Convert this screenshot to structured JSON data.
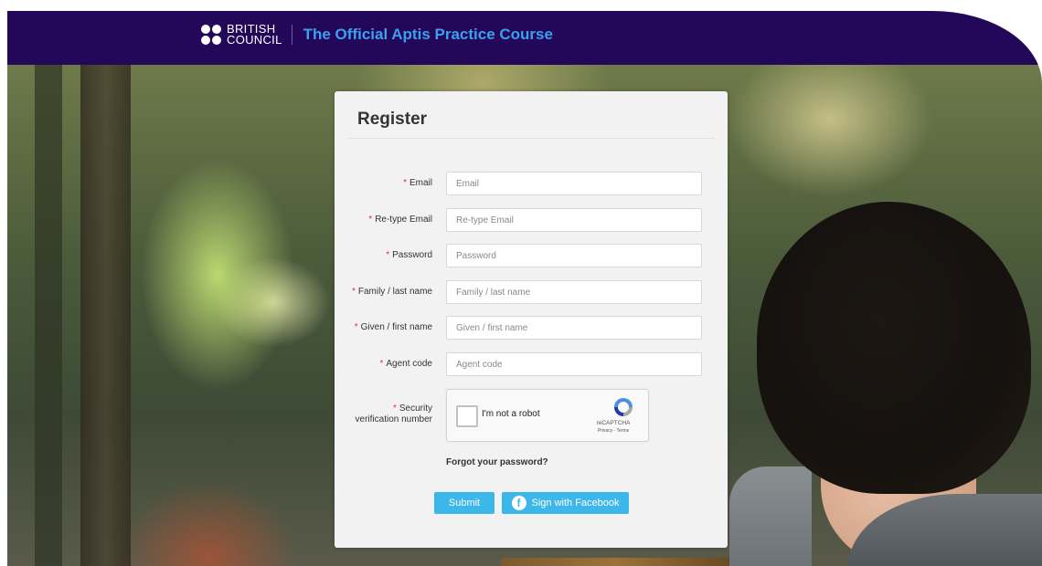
{
  "header": {
    "brand_line1": "BRITISH",
    "brand_line2": "COUNCIL",
    "course_title": "The Official Aptis Practice Course"
  },
  "form": {
    "title": "Register",
    "fields": [
      {
        "label": "Email",
        "placeholder": "Email",
        "value": ""
      },
      {
        "label": "Re-type Email",
        "placeholder": "Re-type Email",
        "value": ""
      },
      {
        "label": "Password",
        "placeholder": "Password",
        "value": ""
      },
      {
        "label": "Family / last name",
        "placeholder": "Family / last name",
        "value": ""
      },
      {
        "label": "Given / first name",
        "placeholder": "Given / first name",
        "value": ""
      },
      {
        "label": "Agent code",
        "placeholder": "Agent code",
        "value": ""
      }
    ],
    "required_marker": "*",
    "security_label_line1": "Security",
    "security_label_line2": "verification number",
    "captcha": {
      "checkbox_label": "I'm not a robot",
      "brand": "reCAPTCHA",
      "links": "Privacy - Terms"
    },
    "forgot_password": "Forgot your password?",
    "submit_label": "Submit",
    "facebook_label": "Sign with Facebook",
    "facebook_icon_glyph": "f"
  },
  "colors": {
    "header_bg": "#23085a",
    "title_blue": "#3aa0f0",
    "button_blue": "#3db7ea",
    "required_red": "#e0333b"
  }
}
